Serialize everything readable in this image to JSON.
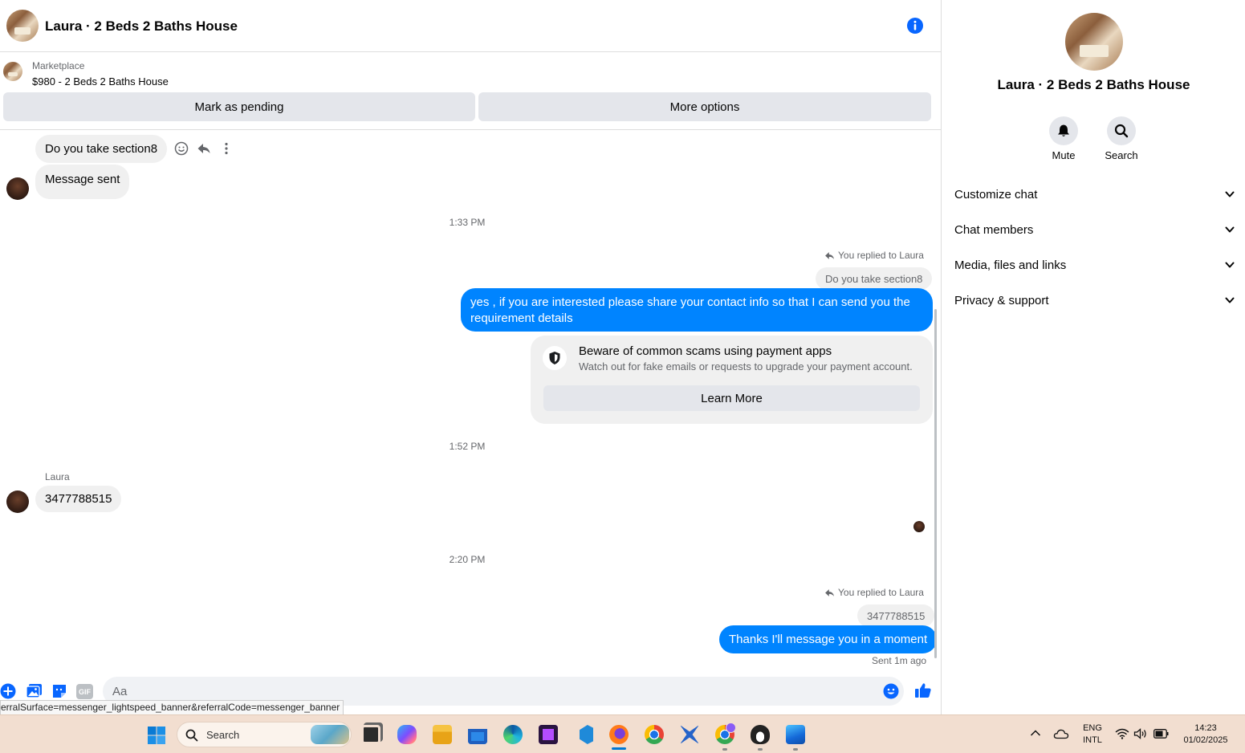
{
  "chat": {
    "title": "Laura · 2 Beds 2 Baths House",
    "listing": {
      "source_label": "Marketplace",
      "listing_title": "$980 - 2 Beds 2 Baths House",
      "mark_pending_label": "Mark as pending",
      "more_options_label": "More options"
    },
    "messages": {
      "msg1": "Do you take section8",
      "msg2": "Message sent",
      "time1": "1:33 PM",
      "reply1_label": "You replied to Laura",
      "reply1_quote": "Do you take section8",
      "reply1_text": "yes , if you are interested please share your contact info so that I can send you the requirement details",
      "scam_title": "Beware of common scams using payment apps",
      "scam_body": "Watch out for fake emails or requests to upgrade your payment account.",
      "learn_more_label": "Learn More",
      "time2": "1:52 PM",
      "sender_name": "Laura",
      "msg3": "3477788515",
      "time3": "2:20 PM",
      "reply2_label": "You replied to Laura",
      "reply2_quote": "3477788515",
      "reply2_text": "Thanks I'll message you in a moment",
      "sent_status": "Sent 1m ago"
    },
    "composer": {
      "placeholder": "Aa",
      "gif_label": "GIF"
    },
    "status_url": "erralSurface=messenger_lightspeed_banner&referralCode=messenger_banner"
  },
  "info_pane": {
    "title": "Laura · 2 Beds 2 Baths House",
    "mute_label": "Mute",
    "search_label": "Search",
    "sections": [
      "Customize chat",
      "Chat members",
      "Media, files and links",
      "Privacy & support"
    ]
  },
  "taskbar": {
    "search_placeholder": "Search",
    "lang_top": "ENG",
    "lang_bottom": "INTL",
    "time": "14:23",
    "date": "01/02/2025",
    "accent": "#0078d4"
  },
  "colors": {
    "messenger_blue": "#0084ff",
    "bubble_grey": "#f0f0f0",
    "taskbar_bg": "#f2ded0"
  }
}
